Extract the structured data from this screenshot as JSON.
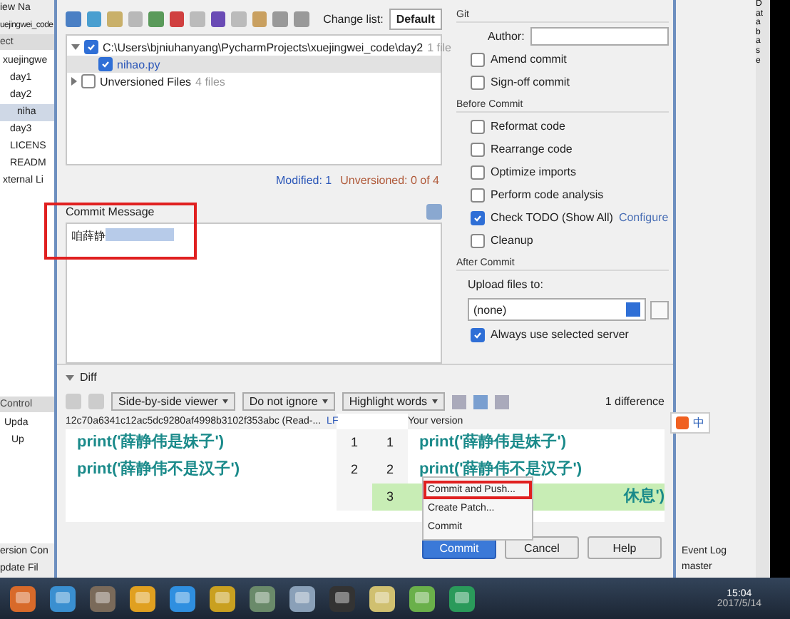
{
  "ide": {
    "menu": [
      "iew",
      "Na"
    ],
    "project_title": "uejingwei_code",
    "panel_label": "ect",
    "tree": [
      {
        "label": "xuejingwe",
        "children": [
          {
            "label": "day1"
          },
          {
            "label": "day2",
            "children": [
              {
                "label": "niha",
                "selected": true
              }
            ]
          },
          {
            "label": "day3"
          },
          {
            "label": "LICENS"
          },
          {
            "label": "READM"
          }
        ]
      },
      {
        "label": "xternal Li"
      }
    ],
    "vc_label": "Control",
    "vc_tree": [
      {
        "label": "Upda"
      },
      {
        "label": "Up"
      }
    ],
    "bottom_tabs": [
      "ersion Con",
      "pdate Fil"
    ],
    "right_tool": "Database",
    "event_log": "Event Log",
    "branch": "master"
  },
  "dialog": {
    "change_list_label": "Change list:",
    "change_list": "Default",
    "changes": [
      {
        "label": "C:\\Users\\bjniuhanyang\\PycharmProjects\\xuejingwei_code\\day2",
        "count": "1 file",
        "checked": true,
        "expanded": true,
        "children": [
          {
            "label": "nihao.py",
            "checked": true,
            "selected": true
          }
        ]
      },
      {
        "label": "Unversioned Files",
        "count": "4 files",
        "checked": false,
        "expanded": false
      }
    ],
    "modified": "Modified: 1",
    "unversioned": "Unversioned: 0 of 4",
    "commit_message_label": "Commit Message",
    "commit_message": "咱薛静",
    "git": {
      "title": "Git",
      "author_label": "Author:",
      "options": [
        {
          "label": "Amend commit",
          "checked": false
        },
        {
          "label": "Sign-off commit",
          "checked": false
        }
      ]
    },
    "before_commit": {
      "title": "Before Commit",
      "options": [
        {
          "label": "Reformat code",
          "checked": false
        },
        {
          "label": "Rearrange code",
          "checked": false
        },
        {
          "label": "Optimize imports",
          "checked": false
        },
        {
          "label": "Perform code analysis",
          "checked": false
        },
        {
          "label": "Check TODO (Show All)",
          "checked": true,
          "link": "Configure"
        },
        {
          "label": "Cleanup",
          "checked": false
        }
      ]
    },
    "after_commit": {
      "title": "After Commit",
      "upload_label": "Upload files to:",
      "server": "(none)",
      "options": [
        {
          "label": "Always use selected server",
          "checked": true
        }
      ]
    },
    "diff": {
      "title": "Diff",
      "expanded": true,
      "viewer": "Side-by-side viewer",
      "ignore": "Do not ignore",
      "highlight": "Highlight words",
      "differences": "1 difference",
      "left_header": "12c70a6341c12ac5dc9280af4998b3102f353abc (Read-...",
      "line_sep": "LF",
      "right_header": "Your version",
      "left_lines": [
        {
          "number": "1",
          "text": "print('薛静伟是妹子')"
        },
        {
          "number": "2",
          "text": "print('薛静伟不是汉子')"
        }
      ],
      "right_lines": [
        {
          "number": "1",
          "text": "print('薛静伟是妹子')",
          "added": false
        },
        {
          "number": "2",
          "text": "print('薛静伟不是汉子')",
          "added": false
        },
        {
          "number": "3",
          "text": "休息')",
          "added": true
        }
      ]
    },
    "menu": [
      {
        "label": "Commit and Push...",
        "selected": true
      },
      {
        "label": "Create Patch...",
        "selected": false
      },
      {
        "label": "Commit",
        "selected": false
      }
    ],
    "buttons": [
      {
        "label": "Commit",
        "default": true
      },
      {
        "label": "Cancel",
        "default": false
      },
      {
        "label": "Help",
        "default": false
      }
    ]
  },
  "ime": {
    "label": "中"
  },
  "taskbar": {
    "time": "15:04",
    "date": "2017/5/14"
  }
}
